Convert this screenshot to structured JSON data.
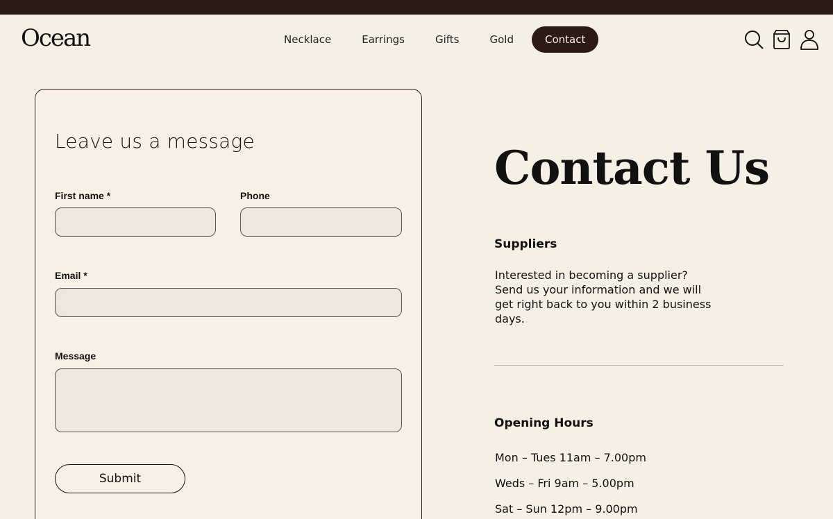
{
  "header": {
    "logo": "Ocean",
    "nav": [
      {
        "label": "Necklace"
      },
      {
        "label": "Earrings"
      },
      {
        "label": "Gifts"
      },
      {
        "label": "Gold"
      },
      {
        "label": "Contact"
      }
    ],
    "icons": [
      "search-icon",
      "cart-icon",
      "user-icon"
    ]
  },
  "form": {
    "title": "Leave us a message",
    "first_name_label": "First name *",
    "phone_label": "Phone",
    "email_label": "Email *",
    "message_label": "Message",
    "first_name_value": "",
    "phone_value": "",
    "email_value": "",
    "message_value": "",
    "submit_label": "Submit"
  },
  "contact": {
    "title": "Contact Us",
    "suppliers_heading": "Suppliers",
    "suppliers_lines": [
      "Interested in becoming a supplier?",
      "Send us your information and we will",
      "get right back to you within 2 business",
      "days."
    ],
    "hours_heading": "Opening Hours",
    "hours": [
      "Mon – Tues 11am – 7.00pm",
      "Weds – Fri 9am – 5.00pm",
      "Sat – Sun 12pm – 9.00pm"
    ]
  },
  "colors": {
    "background": "#f4f0e6",
    "accent": "#2e1a15",
    "field": "#ece8de"
  }
}
